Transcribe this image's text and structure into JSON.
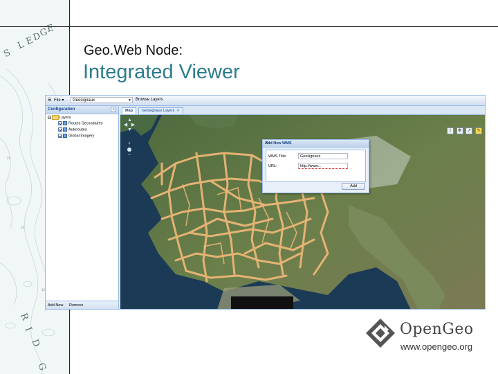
{
  "slide": {
    "title": "Geo.Web Node:",
    "heading": "Integrated Viewer",
    "decor_letters": [
      "S",
      "L",
      "E",
      "D",
      "G",
      "E",
      "R",
      "I",
      "D",
      "G"
    ]
  },
  "app": {
    "toolbar": {
      "file_label": "File",
      "layer_select_value": "Geosignaux",
      "browse_layers_label": "Browse Layers"
    },
    "sidebar": {
      "title": "Configuration",
      "tree_root": "Layers",
      "layers": [
        {
          "label": "Routes Secondaires",
          "checked": true
        },
        {
          "label": "Autoroutes",
          "checked": true
        },
        {
          "label": "Global Imagery",
          "checked": true
        }
      ],
      "add_new_label": "Add New",
      "remove_label": "Remove"
    },
    "tabs": [
      {
        "label": "Map",
        "active": true
      },
      {
        "label": "Geosignaux Layers",
        "active": false,
        "closable": true
      }
    ],
    "map_tools": [
      "info-tool",
      "pan-tool",
      "measure-tool",
      "identify-tool"
    ],
    "dialog": {
      "title": "Add New WMS",
      "title_field_label": "WMS Title:",
      "title_field_value": "Geosignaux",
      "url_field_label": "URL:",
      "url_field_value": "http://www...",
      "add_button_label": "Add"
    }
  },
  "logo": {
    "name": "OpenGeo",
    "url": "www.opengeo.org"
  },
  "colors": {
    "heading": "#2c7c8c",
    "app_panel": "#dfe8f6",
    "roads": "#f0b878",
    "logo": "#444444"
  }
}
